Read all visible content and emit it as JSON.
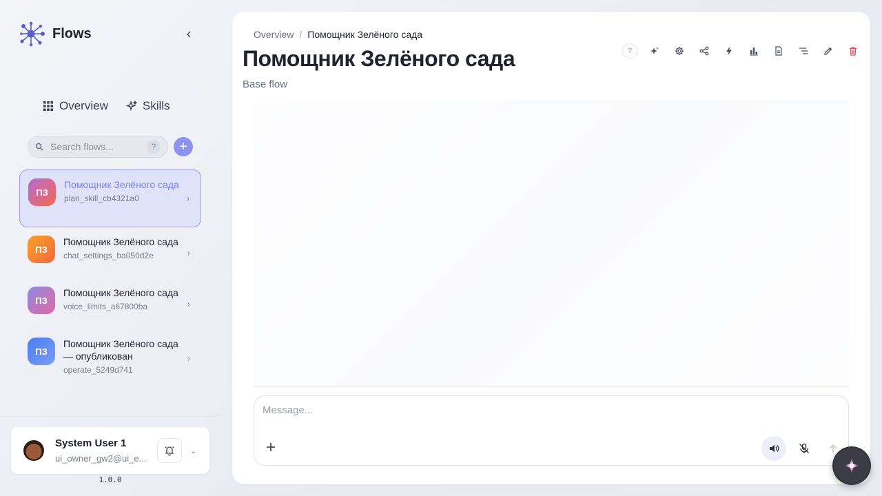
{
  "app": {
    "title": "Flows"
  },
  "nav": {
    "overview": "Overview",
    "skills": "Skills"
  },
  "search": {
    "placeholder": "Search flows...",
    "help": "?"
  },
  "add_button": "+",
  "flows": [
    {
      "initials": "ПЗ",
      "name": "Помощник Зелёного сада",
      "sub": "plan_skill_cb4321a0",
      "active": true,
      "color": "linear-gradient(135deg,#b86ad0,#f06b4f)"
    },
    {
      "initials": "ПЗ",
      "name": "Помощник Зелёного сада",
      "sub": "chat_settings_ba050d2e",
      "active": false,
      "color": "linear-gradient(135deg,#f7a12a,#f36a3a)"
    },
    {
      "initials": "ПЗ",
      "name": "Помощник Зелёного сада",
      "sub": "voice_limits_a67800ba",
      "active": false,
      "color": "linear-gradient(135deg,#8e8ae0,#e06aa6)"
    },
    {
      "initials": "ПЗ",
      "name": "Помощник Зелёного сада — опубликован",
      "sub": "operate_5249d741",
      "active": false,
      "color": "linear-gradient(135deg,#4a7df0,#7a9ef8)"
    }
  ],
  "user": {
    "name": "System User 1",
    "email": "ui_owner_gw2@ui_e..."
  },
  "version": "1.0.0",
  "breadcrumb": {
    "root": "Overview",
    "separator": "/",
    "current": "Помощник Зелёного сада"
  },
  "page": {
    "title": "Помощник Зелёного сада",
    "subtitle": "Base flow"
  },
  "toolbar": {
    "help": "?"
  },
  "composer": {
    "placeholder": "Message..."
  },
  "colors": {
    "accent": "#8c93ef",
    "danger": "#e0455c",
    "text": "#1f2330"
  }
}
